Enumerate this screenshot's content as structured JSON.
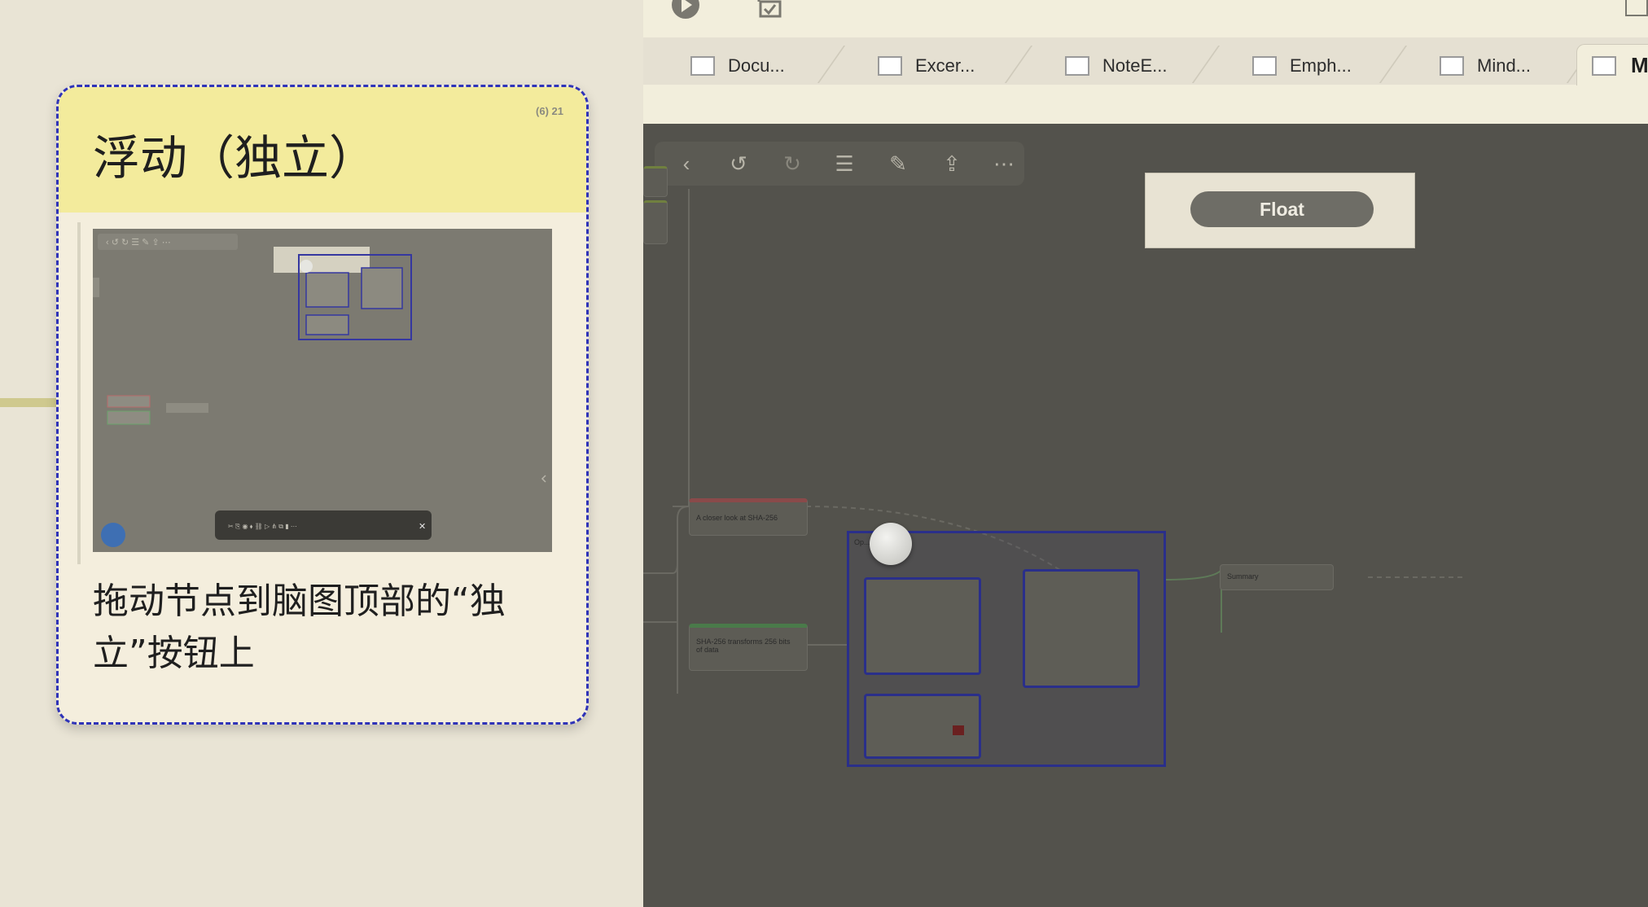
{
  "card": {
    "title": "浮动（独立）",
    "badge": "(6) 21",
    "text": "拖动节点到脑图顶部的“独立”按钮上",
    "image_toolbar_labels": [
      "Cut",
      "Copy",
      "Color",
      "Tag",
      "Link",
      "Summary",
      "Regroup",
      "Merge",
      "Delete",
      "More"
    ]
  },
  "window": {
    "tabs": [
      {
        "label": "Docu..."
      },
      {
        "label": "Excer..."
      },
      {
        "label": "NoteE..."
      },
      {
        "label": "Emph..."
      },
      {
        "label": "Mind..."
      }
    ],
    "active_tab_initial": "M"
  },
  "mindmap": {
    "float_button_label": "Float",
    "toolbar_icons": [
      "back-icon",
      "undo-icon",
      "redo-icon",
      "list-icon",
      "edit-icon",
      "share-icon",
      "more-icon"
    ],
    "nodes": {
      "a_closer_look": "A closer look at SHA-256",
      "sha256_transforms": "SHA-256 transforms 256 bits of data",
      "summary": "Summary",
      "group_label": "Op..."
    }
  },
  "colors": {
    "card_border": "#2f33b8",
    "card_header": "#f3eb9c",
    "canvas_dim": "#53524c"
  }
}
